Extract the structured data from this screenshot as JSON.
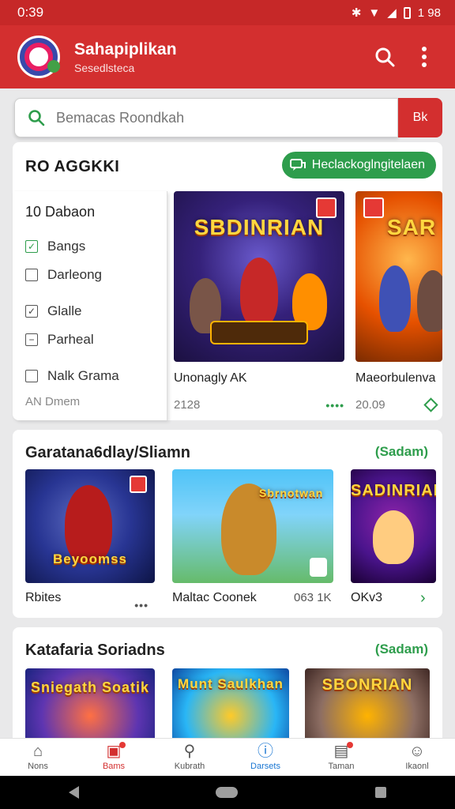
{
  "status": {
    "time": "0:39",
    "right": "1 98"
  },
  "app": {
    "title": "Sahapiplikan",
    "subtitle": "Sesedlsteca"
  },
  "search": {
    "placeholder": "Bemacas Roondkah",
    "button": "Bk"
  },
  "filter": {
    "heading": "RO AGGKKI",
    "chip": "Heclackoglngitelaen",
    "panel_title": "10  Dabaon",
    "options": [
      {
        "label": "Bangs",
        "state": "checked"
      },
      {
        "label": "Darleong",
        "state": "unchecked"
      },
      {
        "label": "Glalle",
        "state": "checked"
      },
      {
        "label": "Parheal",
        "state": "indeterminate"
      },
      {
        "label": "Nalk Grama",
        "state": "unchecked"
      }
    ],
    "footer": "AN  Dmem"
  },
  "featured": [
    {
      "art_title": "SBDINRIAN",
      "name": "Unonagly AK",
      "meta": "2128"
    },
    {
      "art_title": "SAR",
      "name": "Maeorbulenva",
      "meta": "20.09"
    }
  ],
  "section1": {
    "title": "Garatana6dlay/Sliamn",
    "more": "(Sadam)",
    "items": [
      {
        "name": "Rbites",
        "art_title": "Beyoomss"
      },
      {
        "name": "Maltac Coonek",
        "meta": "063 1K",
        "art_title": "Sbrnotwan"
      },
      {
        "name": "OKv3",
        "art_title": "SADINRIAN"
      }
    ]
  },
  "section2": {
    "title": "Katafaria Soriadns",
    "more": "(Sadam)",
    "items": [
      {
        "art_title": "Sniegath  Soatik"
      },
      {
        "art_title": "Munt  Saulkhan"
      },
      {
        "art_title": "SBONRIAN"
      }
    ]
  },
  "bottom_nav": [
    {
      "label": "Nons",
      "icon": "home-icon"
    },
    {
      "label": "Bams",
      "icon": "games-icon"
    },
    {
      "label": "Kubrath",
      "icon": "search-icon"
    },
    {
      "label": "Darsets",
      "icon": "info-icon"
    },
    {
      "label": "Taman",
      "icon": "inbox-icon"
    },
    {
      "label": "Ikaonl",
      "icon": "profile-icon"
    }
  ],
  "colors": {
    "primary": "#d32f2f",
    "accent": "#2e9d4c",
    "active_nav": "#1976d2"
  }
}
